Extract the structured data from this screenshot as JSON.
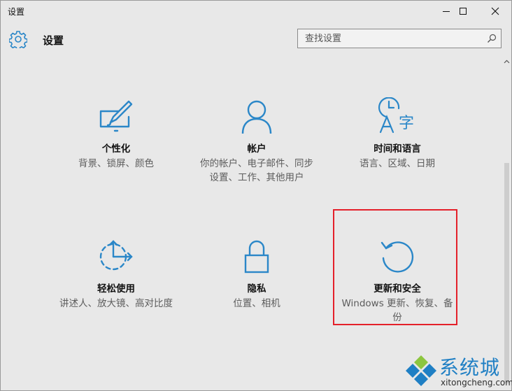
{
  "window": {
    "title": "设置"
  },
  "header": {
    "title": "设置"
  },
  "search": {
    "placeholder": "查找设置"
  },
  "tiles": [
    {
      "name": "个性化",
      "desc": "背景、锁屏、颜色"
    },
    {
      "name": "帐户",
      "desc": "你的帐户、电子邮件、同步设置、工作、其他用户"
    },
    {
      "name": "时间和语言",
      "desc": "语言、区域、日期"
    },
    {
      "name": "轻松使用",
      "desc": "讲述人、放大镜、高对比度"
    },
    {
      "name": "隐私",
      "desc": "位置、相机"
    },
    {
      "name": "更新和安全",
      "desc": "Windows 更新、恢复、备份"
    }
  ],
  "watermark": {
    "brand": "系统城",
    "url": "xitongcheng.com"
  },
  "colors": {
    "accent": "#2b87c8",
    "highlight": "#e4202a",
    "background": "#e8e8e8"
  }
}
